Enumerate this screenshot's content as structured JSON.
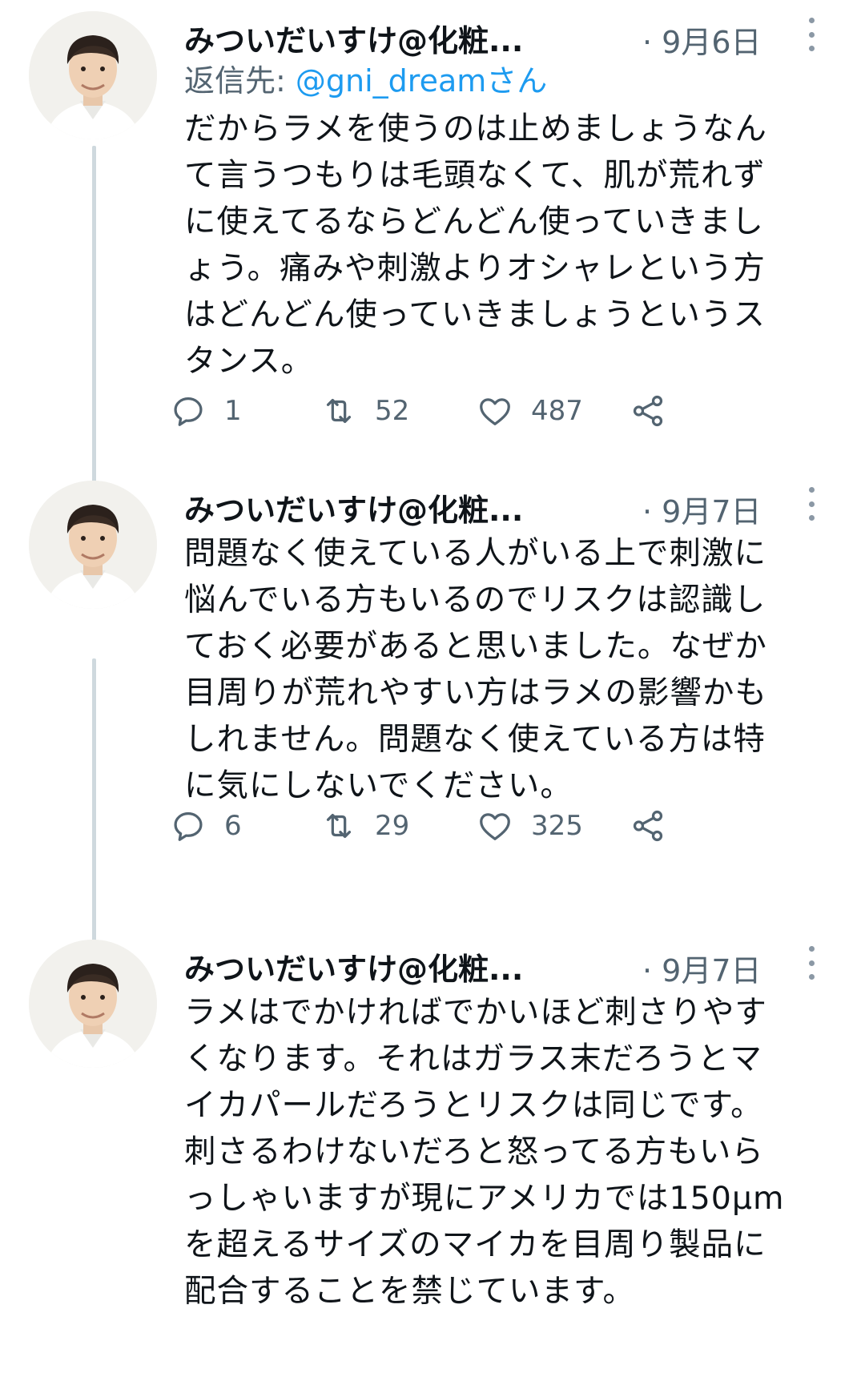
{
  "tweets": [
    {
      "author": "みついだいすけ@化粧...",
      "date": "· 9月6日",
      "reply_prefix": "返信先: ",
      "reply_handle": "@gni_dreamさん",
      "text": "だからラメを使うのは止めましょうなん\nて言うつもりは毛頭なくて、肌が荒れず\nに使えてるならどんどん使っていきまし\nょう。痛みや刺激よりオシャレという方\nはどんどん使っていきましょうというス\nタンス。",
      "replies": "1",
      "retweets": "52",
      "likes": "487"
    },
    {
      "author": "みついだいすけ@化粧...",
      "date": "· 9月7日",
      "text": "問題なく使えている人がいる上で刺激に\n悩んでいる方もいるのでリスクは認識し\nておく必要があると思いました。なぜか\n目周りが荒れやすい方はラメの影響かも\nしれません。問題なく使えている方は特\nに気にしないでください。",
      "replies": "6",
      "retweets": "29",
      "likes": "325"
    },
    {
      "author": "みついだいすけ@化粧...",
      "date": "· 9月7日",
      "text": "ラメはでかければでかいほど刺さりやす\nくなります。それはガラス末だろうとマ\nイカパールだろうとリスクは同じです。\n刺さるわけないだろと怒ってる方もいら\nっしゃいますが現にアメリカでは150μm\nを超えるサイズのマイカを目周り製品に\n配合することを禁じています。"
    }
  ],
  "colors": {
    "text": "#0f1419",
    "secondary": "#536471",
    "link": "#1d9bf0",
    "thread_line": "#cfd9de"
  },
  "icons": [
    "reply-icon",
    "retweet-icon",
    "like-icon",
    "share-icon",
    "more-icon"
  ]
}
